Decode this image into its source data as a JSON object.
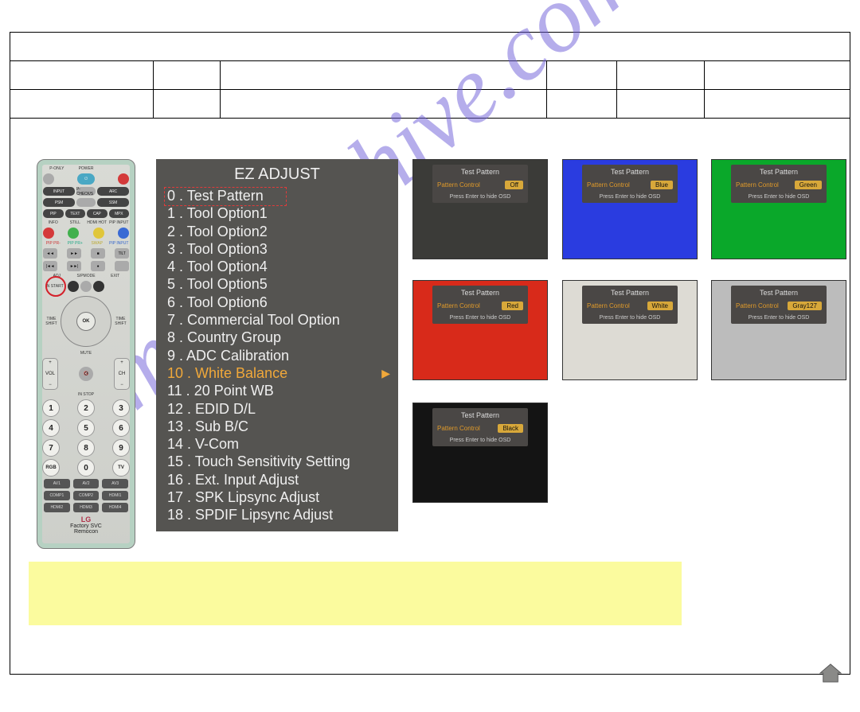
{
  "remote": {
    "power_label": "POWER",
    "row2": [
      "INPUT",
      "",
      "ARC"
    ],
    "pcheck": "P-CHECK/S",
    "row3": [
      "PSM",
      "",
      "SSM"
    ],
    "row4": [
      "PIP",
      "TEXT",
      "CAP",
      "MPX"
    ],
    "row5_labels": [
      "INFO",
      "STILL",
      "HDMI HOT",
      "PIP INPUT"
    ],
    "row6_labels": [
      "PIP PR-",
      "PIP PR+",
      "SWAP",
      "PIP INPUT"
    ],
    "transport": [
      "◄◄",
      "►►",
      "■"
    ],
    "adj_label": "ADJ",
    "instart_label": "IN START",
    "exit_label": "EXIT",
    "timeshift_l": "TIME SHIFT",
    "timeshift_r": "TIME SHIFT",
    "ok": "OK",
    "mute": "MUTE",
    "vol": "VOL",
    "ch": "CH",
    "instop": "IN STOP",
    "nums": [
      "1",
      "2",
      "3",
      "4",
      "5",
      "6",
      "7",
      "8",
      "9",
      "0"
    ],
    "rgb": "RGB",
    "tv": "TV",
    "av_row": [
      "AV1",
      "AV2",
      "AV3"
    ],
    "comp_row": [
      "COMP1",
      "COMP2",
      "HDMI1"
    ],
    "hdmi_row": [
      "HDMI2",
      "HDMI3",
      "HDMI4"
    ],
    "brand": "LG",
    "brand_sub1": "Factory SVC",
    "brand_sub2": "Remocon"
  },
  "ez": {
    "title": "EZ ADJUST",
    "items": [
      "0 . Test Pattern",
      "1 . Tool Option1",
      "2 . Tool Option2",
      "3 . Tool Option3",
      "4 . Tool Option4",
      "5 . Tool Option5",
      "6 . Tool Option6",
      "7 . Commercial Tool Option",
      "8 . Country Group",
      "9 . ADC Calibration",
      "10 . White Balance",
      "11 . 20 Point WB",
      "12 . EDID D/L",
      "13 . Sub B/C",
      "14 . V-Com",
      "15 . Touch Sensitivity Setting",
      "16 . Ext. Input Adjust",
      "17 . SPK Lipsync Adjust",
      "18 . SPDIF Lipsync Adjust"
    ],
    "selected_index": 10,
    "boxed_index": 0,
    "arrow": "▶"
  },
  "osd": {
    "title": "Test Pattern",
    "pattern_label": "Pattern Control",
    "hint": "Press Enter to hide OSD"
  },
  "thumbs": [
    {
      "pos": "r1 c1",
      "bg": "off-bg",
      "badge": "Off"
    },
    {
      "pos": "r1 c2",
      "bg": "blue-bg",
      "badge": "Blue"
    },
    {
      "pos": "r1 c3",
      "bg": "green-bg",
      "badge": "Green"
    },
    {
      "pos": "r2 c1",
      "bg": "red-bg",
      "badge": "Red"
    },
    {
      "pos": "r2 c2",
      "bg": "white-bg",
      "badge": "White"
    },
    {
      "pos": "r2 c3",
      "bg": "gray-bg",
      "badge": "Gray127"
    },
    {
      "pos": "r3 c1",
      "bg": "black-bg",
      "badge": "Black"
    }
  ],
  "watermark": "manualshive.com"
}
